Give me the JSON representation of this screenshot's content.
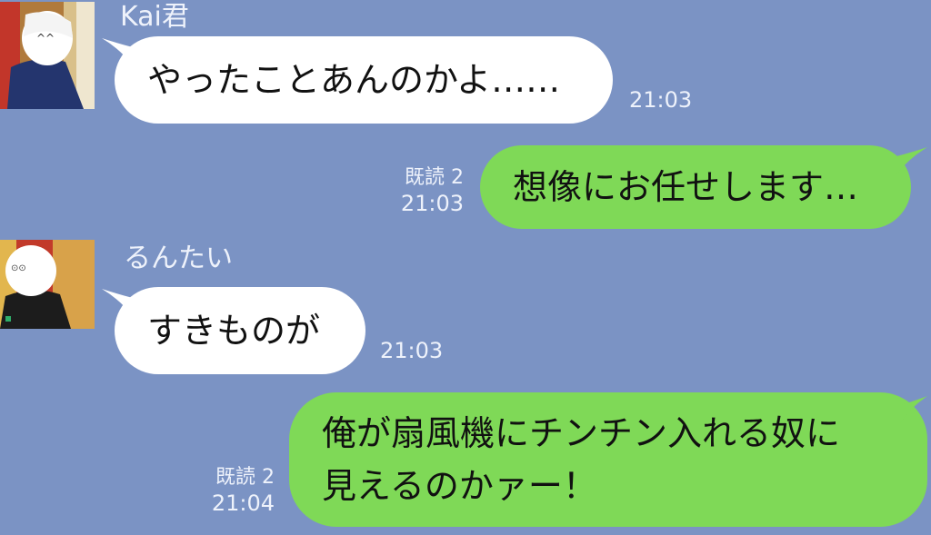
{
  "messages": [
    {
      "sender": "Kai君",
      "text": "やったことあんのかよ……",
      "time": "21:03",
      "direction": "incoming",
      "avatar_icon": "contact-photo-icon"
    },
    {
      "text": "想像にお任せします…",
      "read": "既読 2",
      "time": "21:03",
      "direction": "outgoing"
    },
    {
      "sender": "るんたい",
      "text": "すきものが",
      "time": "21:03",
      "direction": "incoming",
      "avatar_icon": "contact-photo-icon"
    },
    {
      "lines": [
        "俺が扇風機にチンチン入れる奴に",
        "見えるのかァー！"
      ],
      "read": "既読 2",
      "time": "21:04",
      "direction": "outgoing"
    }
  ],
  "colors": {
    "background": "#7b93c4",
    "incoming_bubble": "#ffffff",
    "outgoing_bubble": "#7fd957"
  }
}
